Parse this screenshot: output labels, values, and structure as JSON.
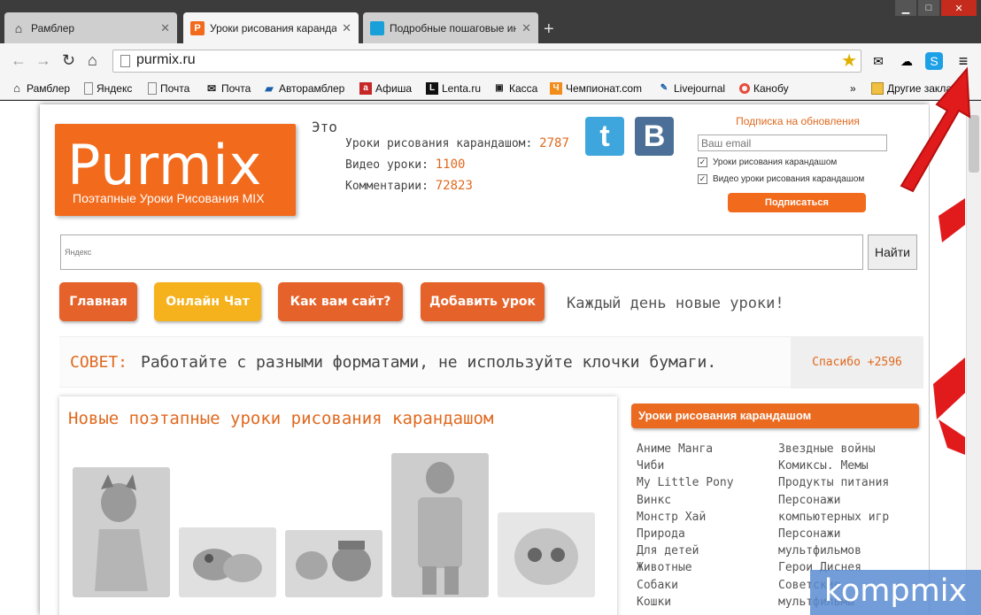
{
  "browser": {
    "tabs": [
      {
        "title": "Рамблер",
        "favicon": "house-icon"
      },
      {
        "title": "Уроки рисования каранда",
        "favicon": "purmix-icon"
      },
      {
        "title": "Подробные пошаговые ин",
        "favicon": "monitor-icon"
      }
    ],
    "url": "purmix.ru",
    "bookmarks": [
      "Рамблер",
      "Яндекс",
      "Почта",
      "Почта",
      "Авторамблер",
      "Афиша",
      "Lenta.ru",
      "Касса",
      "Чемпионат.com",
      "Livejournal",
      "Канобу"
    ],
    "bookmarks_more": "»",
    "other_bookmarks": "Другие закладки"
  },
  "logo": {
    "name": "Purmix",
    "tagline": "Поэтапные Уроки Рисования MIX"
  },
  "stats": {
    "intro": "Это",
    "rows": [
      {
        "label": "Уроки рисования карандашом:",
        "value": "2787"
      },
      {
        "label": "Видео уроки:",
        "value": "1100"
      },
      {
        "label": "Комментарии:",
        "value": "72823"
      }
    ]
  },
  "social": {
    "tumblr": "t",
    "vk": "B"
  },
  "subscribe": {
    "title": "Подписка на обновления",
    "placeholder": "Ваш email",
    "options": [
      "Уроки рисования карандашом",
      "Видео уроки рисования карандашом"
    ],
    "button": "Подписаться"
  },
  "search": {
    "placeholder": "Яндекс",
    "button": "Найти"
  },
  "nav": {
    "home": "Главная",
    "chat": "Онлайн Чат",
    "feedback": "Как вам сайт?",
    "add": "Добавить урок",
    "slogan": "Каждый день новые уроки!"
  },
  "tip": {
    "label": "СОВЕТ:",
    "text": "Работайте с разными форматами, не используйте клочки бумаги.",
    "thanks": "Спасибо +2596"
  },
  "lessons": {
    "title": "Новые поэтапные уроки рисования карандашом"
  },
  "sidebar": {
    "title": "Уроки рисования карандашом",
    "col1": [
      "Аниме Манга",
      "Чиби",
      "My Little Pony",
      "Винкс",
      "Монстр Хай",
      "Природа",
      "Для детей",
      "Животные",
      "Собаки",
      "Кошки"
    ],
    "col2": [
      "Звездные войны",
      "Комиксы. Мемы",
      "Продукты питания",
      "Персонажи",
      "компьютерных игр",
      "Персонажи",
      "мультфильмов",
      "Герои Диснея",
      "Советские",
      "мультфильмы"
    ]
  },
  "watermark": "kompmix",
  "colors": {
    "accent": "#f26a1b",
    "yellow": "#f5b21d",
    "red_arrow": "#e11b1b"
  }
}
